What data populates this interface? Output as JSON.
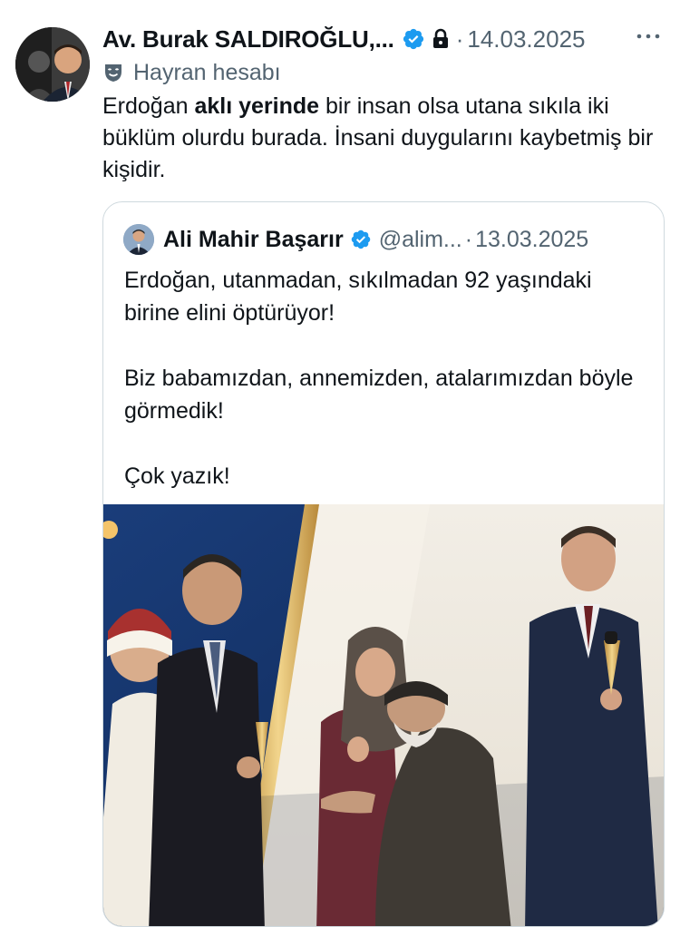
{
  "tweet": {
    "author_name": "Av. Burak SALDIROĞLU,...",
    "separator": "·",
    "date": "14.03.2025",
    "fan_label": "Hayran hesabı",
    "text_part1": "Erdoğan ",
    "text_bold": "aklı yerinde",
    "text_part2": " bir insan olsa utana sıkıla iki büklüm olurdu burada. İnsani duygularını kaybetmiş bir kişidir.",
    "icons": [
      "verified-badge-icon",
      "lock-icon",
      "more-icon",
      "theater-mask-icon"
    ]
  },
  "quote": {
    "author_name": "Ali Mahir Başarır",
    "handle": "@alim...",
    "separator": "·",
    "date": "13.03.2025",
    "paragraph1": "Erdoğan, utanmadan, sıkılmadan 92 yaşındaki birine elini öptürüyor!",
    "paragraph2": "Biz babamızdan, annemizden, atalarımızdan böyle görmedik!",
    "paragraph3": "Çok yazık!"
  },
  "colors": {
    "verified_blue": "#1d9bf0",
    "secondary_text": "#536471",
    "border": "#cfd9de"
  }
}
